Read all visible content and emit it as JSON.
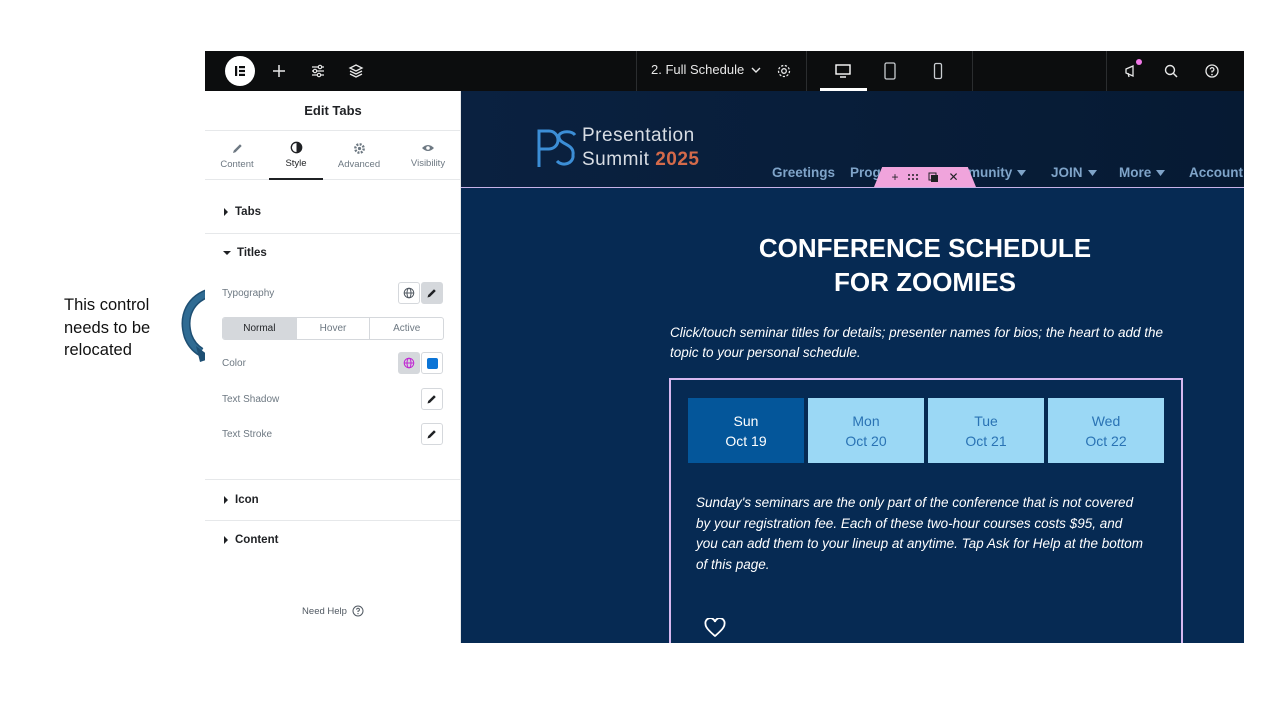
{
  "annotation": {
    "text": "This control needs to be relocated"
  },
  "topbar": {
    "page_name": "2. Full Schedule"
  },
  "panel": {
    "title": "Edit Tabs",
    "tabs": [
      {
        "label": "Content",
        "icon": "pencil-icon"
      },
      {
        "label": "Style",
        "icon": "half-circle-icon"
      },
      {
        "label": "Advanced",
        "icon": "gear-icon"
      },
      {
        "label": "Visibility",
        "icon": "eye-icon"
      }
    ],
    "sections": {
      "tabs": "Tabs",
      "titles": "Titles",
      "icon": "Icon",
      "content": "Content"
    },
    "controls": {
      "typography": "Typography",
      "states": [
        "Normal",
        "Hover",
        "Active"
      ],
      "color": "Color",
      "text_shadow": "Text Shadow",
      "text_stroke": "Text Stroke"
    },
    "need_help": "Need Help",
    "swatch_color": "#0b74d6"
  },
  "site": {
    "brand_line1": "Presentation",
    "brand_line2": "Summit",
    "brand_year": "2025",
    "nav": [
      "Greetings",
      "Prog",
      "munity",
      "JOIN",
      "More",
      "Account"
    ],
    "title_line1": "CONFERENCE SCHEDULE",
    "title_line2": "FOR ZOOMIES",
    "intro": "Click/touch seminar titles for details; presenter names for bios; the heart to add the topic to your personal schedule.",
    "days": [
      {
        "day": "Sun",
        "date": "Oct 19"
      },
      {
        "day": "Mon",
        "date": "Oct 20"
      },
      {
        "day": "Tue",
        "date": "Oct 21"
      },
      {
        "day": "Wed",
        "date": "Oct 22"
      }
    ],
    "tab_description": "Sunday's seminars are the only part of the conference that is not covered by your registration fee. Each of these two-hour courses costs $95, and you can add them to your lineup at anytime. Tap Ask for Help  at the bottom of this page."
  }
}
